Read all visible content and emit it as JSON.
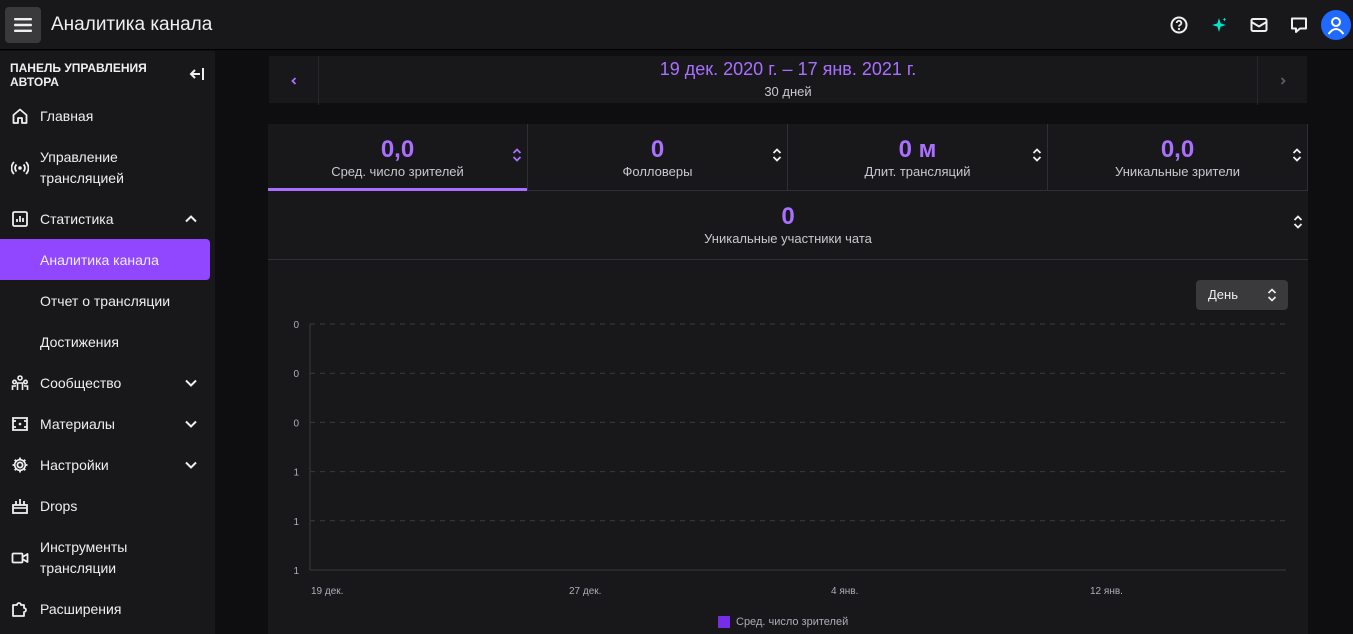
{
  "topbar": {
    "title": "Аналитика канала",
    "icons": [
      "menu-icon",
      "help-icon",
      "sparkle-icon",
      "inbox-icon",
      "whispers-icon",
      "user-avatar-icon"
    ]
  },
  "sidebar": {
    "header": "Панель управления автора",
    "items": [
      {
        "label": "Главная",
        "icon": "home-icon"
      },
      {
        "label": "Управление трансляцией",
        "icon": "broadcast-icon"
      },
      {
        "label": "Статистика",
        "icon": "stats-icon",
        "expanded": true
      },
      {
        "label": "Аналитика канала",
        "active": true
      },
      {
        "label": "Отчет о трансляции"
      },
      {
        "label": "Достижения"
      },
      {
        "label": "Сообщество",
        "icon": "community-icon"
      },
      {
        "label": "Материалы",
        "icon": "content-icon"
      },
      {
        "label": "Настройки",
        "icon": "settings-icon"
      },
      {
        "label": "Drops",
        "icon": "drops-icon"
      },
      {
        "label": "Инструменты трансляции",
        "icon": "camera-icon"
      },
      {
        "label": "Расширения",
        "icon": "puzzle-icon"
      }
    ]
  },
  "date": {
    "range": "19 дек. 2020 г. – 17 янв. 2021 г.",
    "sub": "30 дней"
  },
  "metrics": [
    {
      "value": "0,0",
      "label": "Сред. число зрителей",
      "active": true
    },
    {
      "value": "0",
      "label": "Фолловеры"
    },
    {
      "value": "0 м",
      "label": "Длит. трансляций"
    },
    {
      "value": "0,0",
      "label": "Уникальные зрители"
    }
  ],
  "metric_wide": {
    "value": "0",
    "label": "Уникальные участники чата"
  },
  "period_select": {
    "value": "День"
  },
  "colors": {
    "accent": "#a970ff",
    "active_nav": "#9147ff",
    "series": "#772ce8",
    "background": "#18181b"
  },
  "chart_data": {
    "type": "line",
    "y_ticks": [
      "0",
      "0",
      "0",
      "1",
      "1",
      "1"
    ],
    "x_ticks": [
      "19 дек.",
      "27 дек.",
      "4 янв.",
      "12 янв."
    ],
    "series": [
      {
        "name": "Сред. число зрителей",
        "values": []
      }
    ],
    "grid": true,
    "legend": "bottom-center"
  }
}
